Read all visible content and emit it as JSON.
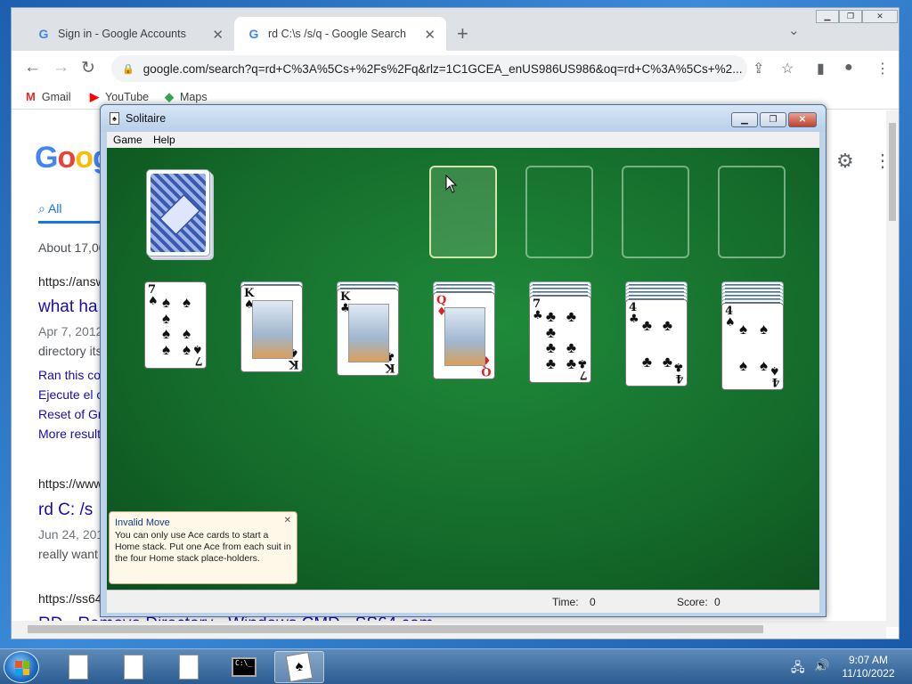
{
  "browser": {
    "tabs": [
      {
        "label": "Sign in - Google Accounts",
        "icon": "google-g-icon"
      },
      {
        "label": "rd C:\\s /s/q - Google Search",
        "icon": "google-g-icon"
      }
    ],
    "url": "google.com/search?q=rd+C%3A%5Cs+%2Fs%2Fq&rlz=1C1GCEA_enUS986US986&oq=rd+C%3A%5Cs+%2...",
    "bookmarks": [
      {
        "label": "Gmail",
        "icon": "gmail-icon"
      },
      {
        "label": "YouTube",
        "icon": "youtube-icon"
      },
      {
        "label": "Maps",
        "icon": "maps-icon"
      }
    ]
  },
  "google_page": {
    "logo": "Goog",
    "tab_all": "All",
    "about": "About 17,00",
    "results": [
      {
        "url": "https://answ",
        "title": "what ha",
        "date": "Apr 7, 2012",
        "snippet": "directory its",
        "sublinks": [
          "Ran this co",
          "Ejecute el c",
          "Reset of Gr",
          "More result"
        ]
      },
      {
        "url": "https://www",
        "title": "rd C: /s",
        "date": "Jun 24, 201",
        "snippet": "really want"
      },
      {
        "url": "https://ss64",
        "title": "RD - Remove Directory - Windows CMD - SS64.com"
      }
    ]
  },
  "solitaire": {
    "title": "Solitaire",
    "menu": [
      "Game",
      "Help"
    ],
    "tableau": [
      {
        "hidden": 0,
        "card": {
          "rank": "7",
          "suit": "♠",
          "color": "black",
          "pips": 7
        }
      },
      {
        "hidden": 1,
        "card": {
          "rank": "K",
          "suit": "♠",
          "color": "black",
          "face": true
        }
      },
      {
        "hidden": 2,
        "card": {
          "rank": "K",
          "suit": "♣",
          "color": "black",
          "face": true
        }
      },
      {
        "hidden": 3,
        "card": {
          "rank": "Q",
          "suit": "♦",
          "color": "red",
          "face": true
        }
      },
      {
        "hidden": 4,
        "card": {
          "rank": "7",
          "suit": "♣",
          "color": "black",
          "pips": 7
        }
      },
      {
        "hidden": 5,
        "card": {
          "rank": "4",
          "suit": "♣",
          "color": "black",
          "pips": 4
        }
      },
      {
        "hidden": 6,
        "card": {
          "rank": "4",
          "suit": "♠",
          "color": "black",
          "pips": 4
        }
      }
    ],
    "tooltip": {
      "title": "Invalid Move",
      "body": "You can only use Ace cards to start a Home stack. Put one Ace from each suit in the four Home stack place-holders."
    },
    "status": {
      "time_label": "Time:",
      "time_value": "0",
      "score_label": "Score:",
      "score_value": "0"
    }
  },
  "taskbar": {
    "clock_time": "9:07 AM",
    "clock_date": "11/10/2022"
  }
}
